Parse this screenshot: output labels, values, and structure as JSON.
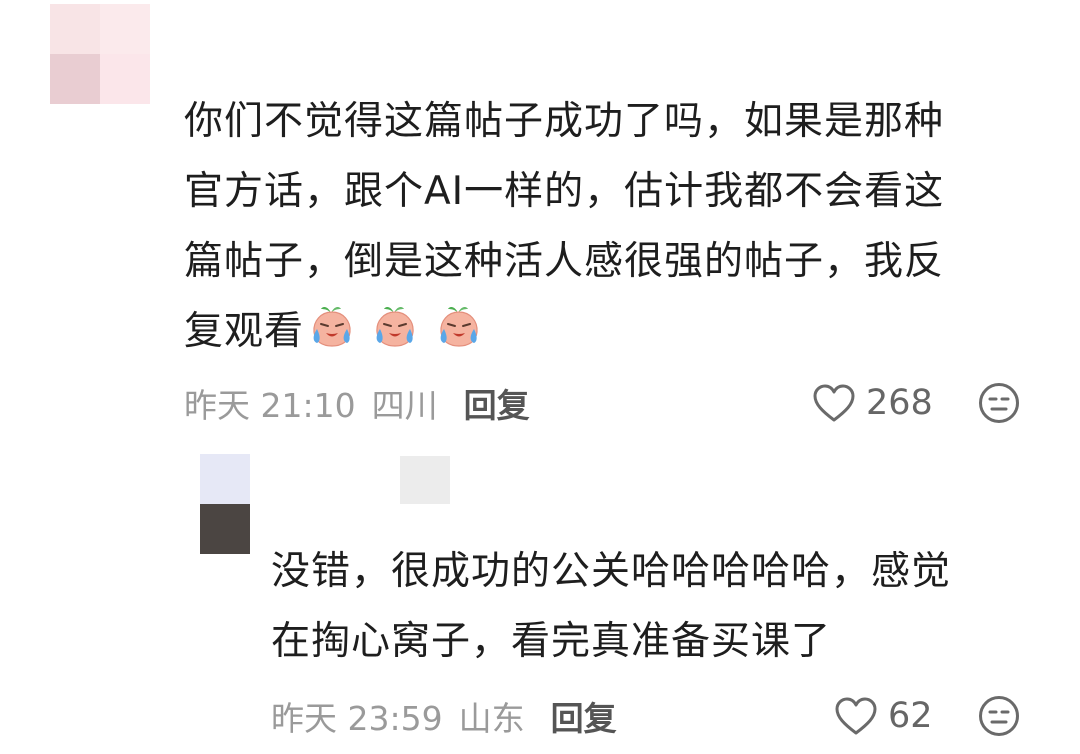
{
  "main_comment": {
    "lines": [
      "你们不觉得这篇帖子成功了吗，如果是那种",
      "官方话，跟个AI一样的，估计我都不会看这",
      "篇帖子，倒是这种活人感很强的帖子，我反",
      "复观看"
    ],
    "emoji": [
      "crying-peach-emoji",
      "crying-peach-emoji",
      "crying-peach-emoji"
    ],
    "time": "昨天 21:10",
    "location": "四川",
    "reply_label": "回复",
    "likes": "268"
  },
  "reply_comment": {
    "lines": [
      "没错，很成功的公关哈哈哈哈哈，感觉",
      "在掏心窝子，看完真准备买课了"
    ],
    "time": "昨天 23:59",
    "location": "山东",
    "reply_label": "回复",
    "likes": "62"
  },
  "icons": {
    "like": "heart-outline-icon",
    "dislike": "dislike-face-icon"
  },
  "colors": {
    "text": "#1e1e1e",
    "meta": "#9a9a9a",
    "reply_button": "#555555",
    "emoji_peach": "#f5b3a0",
    "emoji_leaf": "#4caf50",
    "emoji_tear": "#5aa7e8"
  }
}
